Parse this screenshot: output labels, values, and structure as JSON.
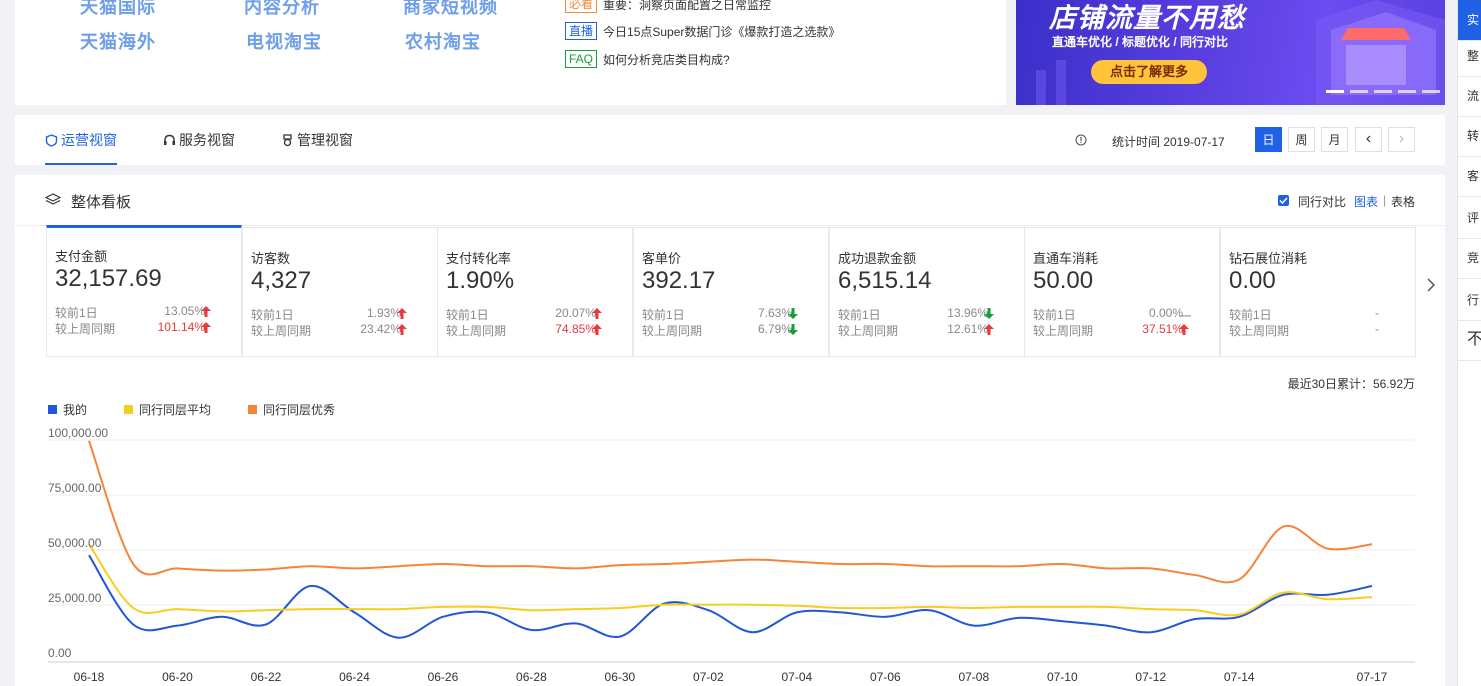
{
  "top_links": [
    "天猫国际",
    "内容分析",
    "商家短视频",
    "天猫海外",
    "电视淘宝",
    "农村淘宝"
  ],
  "notices": [
    {
      "tag": "必看",
      "text": "重要：洞察页面配置之日常监控",
      "color": "#f08a3c"
    },
    {
      "tag": "直播",
      "text": "今日15点Super数据门诊《爆款打造之选款》",
      "color": "#2062e6"
    },
    {
      "tag": "FAQ",
      "text": "如何分析竞店类目构成?",
      "color": "#1a9b3d"
    }
  ],
  "banner": {
    "title": "店铺流量不用愁",
    "subtitle": "直通车优化 / 标题优化 / 同行对比",
    "cta": "点击了解更多"
  },
  "right_rail": [
    "实",
    "整",
    "流",
    "转",
    "客",
    "评",
    "竞",
    "行",
    "不"
  ],
  "tabs": {
    "operations": "运营视窗",
    "service": "服务视窗",
    "management": "管理视窗"
  },
  "stat_time": "统计时间 2019-07-17",
  "date_buttons": {
    "day": "日",
    "week": "周",
    "month": "月",
    "prev": "‹",
    "next": "›"
  },
  "panel": {
    "title": "整体看板",
    "peer_compare": "同行对比",
    "view_chart": "图表",
    "separator": "|",
    "view_table": "表格"
  },
  "metrics": [
    {
      "label": "支付金额",
      "value": "32,157.69",
      "r1k": "较前1日",
      "r1v": "13.05%",
      "r1dir": "up",
      "r1red": false,
      "r2k": "较上周同期",
      "r2v": "101.14%",
      "r2dir": "up",
      "r2red": true
    },
    {
      "label": "访客数",
      "value": "4,327",
      "r1k": "较前1日",
      "r1v": "1.93%",
      "r1dir": "up",
      "r1red": false,
      "r2k": "较上周同期",
      "r2v": "23.42%",
      "r2dir": "up",
      "r2red": false
    },
    {
      "label": "支付转化率",
      "value": "1.90%",
      "r1k": "较前1日",
      "r1v": "20.07%",
      "r1dir": "up",
      "r1red": false,
      "r2k": "较上周同期",
      "r2v": "74.85%",
      "r2dir": "up",
      "r2red": true
    },
    {
      "label": "客单价",
      "value": "392.17",
      "r1k": "较前1日",
      "r1v": "7.63%",
      "r1dir": "down",
      "r1red": false,
      "r2k": "较上周同期",
      "r2v": "6.79%",
      "r2dir": "down",
      "r2red": false
    },
    {
      "label": "成功退款金额",
      "value": "6,515.14",
      "r1k": "较前1日",
      "r1v": "13.96%",
      "r1dir": "down",
      "r1red": false,
      "r2k": "较上周同期",
      "r2v": "12.61%",
      "r2dir": "up",
      "r2red": false
    },
    {
      "label": "直通车消耗",
      "value": "50.00",
      "r1k": "较前1日",
      "r1v": "0.00%",
      "r1dir": "flat",
      "r1red": false,
      "r2k": "较上周同期",
      "r2v": "37.51%",
      "r2dir": "up",
      "r2red": true
    },
    {
      "label": "钻石展位消耗",
      "value": "0.00",
      "r1k": "较前1日",
      "r1v": "-",
      "r1dir": "none",
      "r1red": false,
      "r2k": "较上周同期",
      "r2v": "-",
      "r2dir": "none",
      "r2red": false
    }
  ],
  "total_note": "最近30日累计：56.92万",
  "colors": {
    "accent": "#2062e6",
    "mine": "#2157d6",
    "avg": "#f5cf1f",
    "top": "#f5843a"
  },
  "chart_data": {
    "type": "line",
    "x": [
      "06-18",
      "06-19",
      "06-20",
      "06-21",
      "06-22",
      "06-23",
      "06-24",
      "06-25",
      "06-26",
      "06-27",
      "06-28",
      "06-29",
      "06-30",
      "07-01",
      "07-02",
      "07-03",
      "07-04",
      "07-05",
      "07-06",
      "07-07",
      "07-08",
      "07-09",
      "07-10",
      "07-11",
      "07-12",
      "07-13",
      "07-14",
      "07-15",
      "07-16",
      "07-17"
    ],
    "xticks": [
      "06-18",
      "06-20",
      "06-22",
      "06-24",
      "06-26",
      "06-28",
      "06-30",
      "07-02",
      "07-04",
      "07-06",
      "07-08",
      "07-10",
      "07-12",
      "07-14",
      "07-17"
    ],
    "yticks": [
      "100,000.00",
      "75,000.00",
      "50,000.00",
      "25,000.00",
      "0.00"
    ],
    "ylim": [
      0,
      100000
    ],
    "legend_position": "top-left",
    "series": [
      {
        "name": "我的",
        "values": [
          44000,
          12500,
          12000,
          16000,
          12500,
          30000,
          18000,
          6500,
          16000,
          18000,
          10000,
          13000,
          7000,
          22000,
          19000,
          9000,
          18000,
          18000,
          16000,
          19000,
          12000,
          15500,
          14000,
          12000,
          9000,
          15000,
          16000,
          26000,
          26000,
          30000
        ]
      },
      {
        "name": "同行同层平均",
        "values": [
          49000,
          20000,
          19500,
          18500,
          19000,
          19500,
          19500,
          19500,
          20500,
          20500,
          19000,
          19500,
          20000,
          21500,
          21500,
          21500,
          21000,
          20000,
          20000,
          20500,
          20000,
          20500,
          20500,
          20500,
          19500,
          19000,
          17000,
          27000,
          24000,
          25000
        ]
      },
      {
        "name": "同行同层优秀",
        "values": [
          96000,
          40000,
          38000,
          37000,
          37500,
          39000,
          38000,
          39000,
          40000,
          39000,
          39000,
          38000,
          39500,
          40000,
          41000,
          42000,
          41000,
          40000,
          40000,
          39000,
          39000,
          39000,
          40000,
          38000,
          38000,
          35000,
          33000,
          57000,
          47000,
          49000
        ]
      }
    ]
  }
}
